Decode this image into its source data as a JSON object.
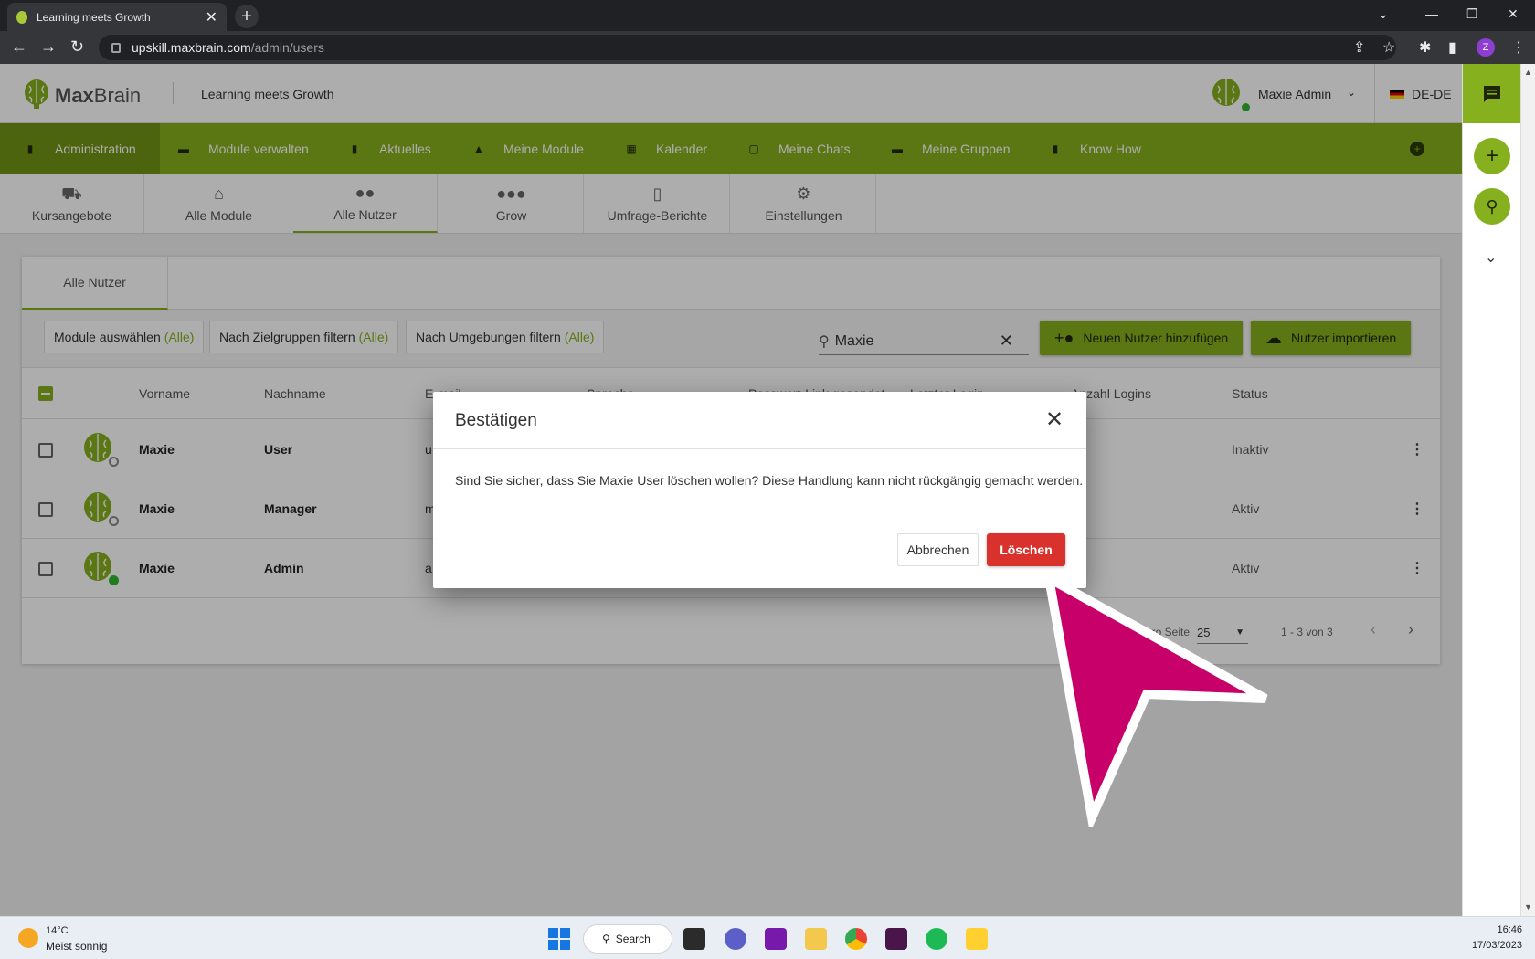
{
  "browser": {
    "tab_title": "Learning meets Growth",
    "url_host": "upskill.maxbrain.com",
    "url_path": "/admin/users",
    "profile_initial": "Z"
  },
  "header": {
    "brand_bold": "Max",
    "brand_rest": "Brain",
    "tagline": "Learning meets Growth",
    "user_name": "Maxie Admin",
    "language": "DE-DE"
  },
  "nav": {
    "items": [
      {
        "label": "Administration",
        "icon": "admin-icon"
      },
      {
        "label": "Module verwalten",
        "icon": "folder-icon"
      },
      {
        "label": "Aktuelles",
        "icon": "news-icon"
      },
      {
        "label": "Meine Module",
        "icon": "graduation-cap-icon"
      },
      {
        "label": "Kalender",
        "icon": "calendar-icon"
      },
      {
        "label": "Meine Chats",
        "icon": "chat-icon"
      },
      {
        "label": "Meine Gruppen",
        "icon": "group-icon"
      },
      {
        "label": "Know How",
        "icon": "book-icon"
      }
    ]
  },
  "sub_tabs": [
    {
      "label": "Kursangebote",
      "icon": "course-icon"
    },
    {
      "label": "Alle Module",
      "icon": "bank-icon"
    },
    {
      "label": "Alle Nutzer",
      "icon": "users-icon"
    },
    {
      "label": "Grow",
      "icon": "people-icon"
    },
    {
      "label": "Umfrage-Berichte",
      "icon": "report-icon"
    },
    {
      "label": "Einstellungen",
      "icon": "gears-icon"
    }
  ],
  "card": {
    "tab_label": "Alle Nutzer",
    "filters": [
      {
        "label": "Module auswählen",
        "value": "(Alle)"
      },
      {
        "label": "Nach Zielgruppen filtern",
        "value": "(Alle)"
      },
      {
        "label": "Nach Umgebungen filtern",
        "value": "(Alle)"
      }
    ],
    "search_value": "Maxie",
    "add_user_label": "Neuen Nutzer hinzufügen",
    "import_label": "Nutzer importieren",
    "columns": [
      "Vorname",
      "Nachname",
      "E-mail",
      "Sprache",
      "Passwort-Link gesendet",
      "Letzter Login",
      "Anzahl Logins",
      "Status"
    ],
    "rows": [
      {
        "first": "Maxie",
        "last": "User",
        "email_initial": "u",
        "status": "Inaktiv",
        "online": false
      },
      {
        "first": "Maxie",
        "last": "Manager",
        "email_initial": "m",
        "status": "Aktiv",
        "online": false
      },
      {
        "first": "Maxie",
        "last": "Admin",
        "email_initial": "a",
        "status": "Aktiv",
        "online": true
      }
    ],
    "pager": {
      "per_page_label": "pro Seite",
      "per_page": "25",
      "range": "1 - 3 von 3"
    }
  },
  "modal": {
    "title": "Bestätigen",
    "message": "Sind Sie sicher, dass Sie Maxie User löschen wollen? Diese Handlung kann nicht rückgängig gemacht werden.",
    "cancel_label": "Abbrechen",
    "delete_label": "Löschen"
  },
  "taskbar": {
    "temp": "14°C",
    "weather": "Meist sonnig",
    "search_label": "Search",
    "time": "16:46",
    "date": "17/03/2023"
  },
  "colors": {
    "brand_green": "#87b01e",
    "delete_red": "#d9312c",
    "cursor_magenta": "#c8006a"
  }
}
